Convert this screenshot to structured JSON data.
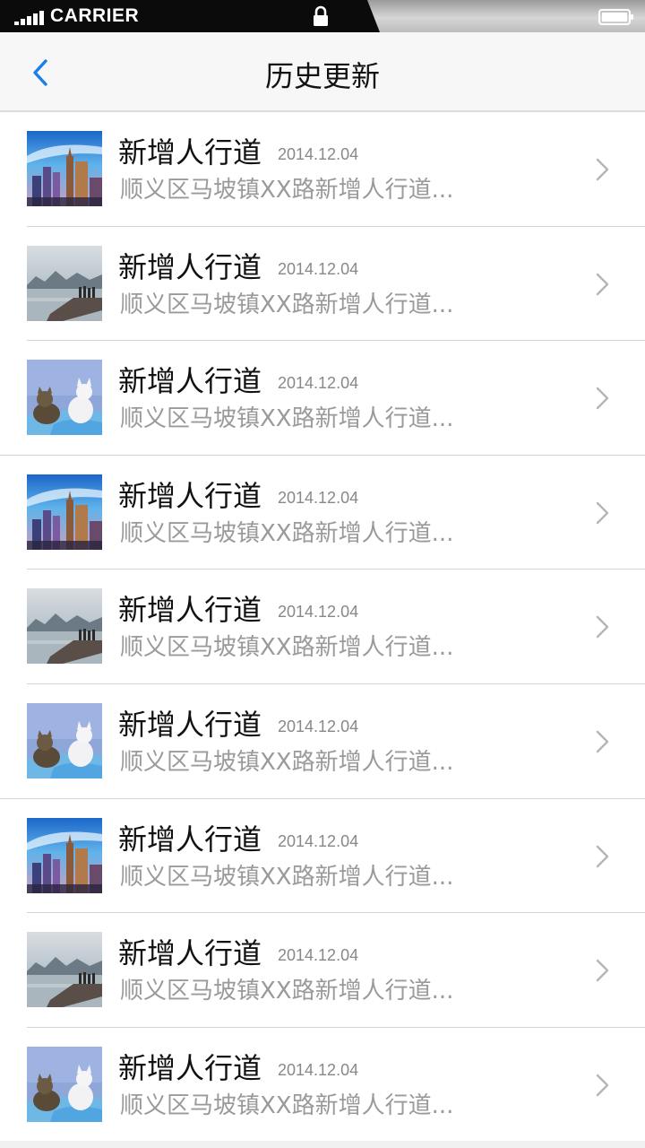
{
  "status_bar": {
    "carrier": "CARRIER",
    "signal_icon": "signal-bars-icon",
    "lock_icon": "lock-icon",
    "battery_icon": "battery-icon"
  },
  "nav": {
    "title": "历史更新",
    "back_icon": "chevron-left-icon",
    "accent_color": "#1a7fe8"
  },
  "items": [
    {
      "title": "新增人行道",
      "date": "2014.12.04",
      "desc": "顺义区马坡镇XX路新增人行道...",
      "thumb": "city"
    },
    {
      "title": "新增人行道",
      "date": "2014.12.04",
      "desc": "顺义区马坡镇XX路新增人行道...",
      "thumb": "lake"
    },
    {
      "title": "新增人行道",
      "date": "2014.12.04",
      "desc": "顺义区马坡镇XX路新增人行道...",
      "thumb": "cats"
    },
    {
      "title": "新增人行道",
      "date": "2014.12.04",
      "desc": "顺义区马坡镇XX路新增人行道...",
      "thumb": "city"
    },
    {
      "title": "新增人行道",
      "date": "2014.12.04",
      "desc": "顺义区马坡镇XX路新增人行道...",
      "thumb": "lake"
    },
    {
      "title": "新增人行道",
      "date": "2014.12.04",
      "desc": "顺义区马坡镇XX路新增人行道...",
      "thumb": "cats"
    },
    {
      "title": "新增人行道",
      "date": "2014.12.04",
      "desc": "顺义区马坡镇XX路新增人行道...",
      "thumb": "city"
    },
    {
      "title": "新增人行道",
      "date": "2014.12.04",
      "desc": "顺义区马坡镇XX路新增人行道...",
      "thumb": "lake"
    },
    {
      "title": "新增人行道",
      "date": "2014.12.04",
      "desc": "顺义区马坡镇XX路新增人行道...",
      "thumb": "cats"
    }
  ]
}
